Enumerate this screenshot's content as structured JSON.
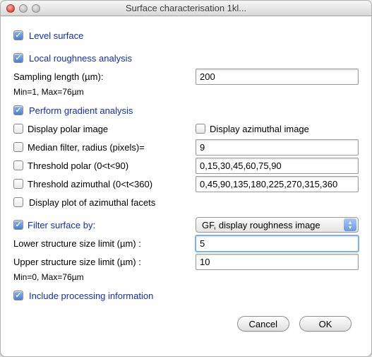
{
  "window": {
    "title": "Surface characterisation 1kl..."
  },
  "level_surface": {
    "label": "Level surface",
    "checked": true
  },
  "local_roughness": {
    "label": "Local roughness analysis",
    "checked": true
  },
  "sampling_length": {
    "label": "Sampling length (µm):",
    "value": "200"
  },
  "sampling_hint": "Min=1, Max=76µm",
  "gradient": {
    "label": "Perform gradient analysis",
    "checked": true
  },
  "display_polar": {
    "label": "Display polar image",
    "checked": false
  },
  "display_azimuthal": {
    "label": "Display azimuthal image",
    "checked": false
  },
  "median_filter": {
    "label": "Median filter, radius (pixels)=",
    "checked": false,
    "value": "9"
  },
  "threshold_polar": {
    "label": "Threshold polar (0<t<90)",
    "checked": false,
    "value": "0,15,30,45,60,75,90"
  },
  "threshold_azimuthal": {
    "label": "Threshold azimuthal (0<t<360)",
    "checked": false,
    "value": "0,45,90,135,180,225,270,315,360"
  },
  "display_plot_facets": {
    "label": "Display plot of azimuthal facets",
    "checked": false
  },
  "filter_surface": {
    "label": "Filter surface by:",
    "checked": true,
    "selected": "GF, display roughness image"
  },
  "lower_limit": {
    "label": "Lower structure size limit (µm) :",
    "value": "5"
  },
  "upper_limit": {
    "label": "Upper structure size limit (µm) :",
    "value": "10"
  },
  "limits_hint": "Min=0, Max=76µm",
  "include_proc": {
    "label": "Include processing information",
    "checked": true
  },
  "buttons": {
    "cancel": "Cancel",
    "ok": "OK"
  }
}
